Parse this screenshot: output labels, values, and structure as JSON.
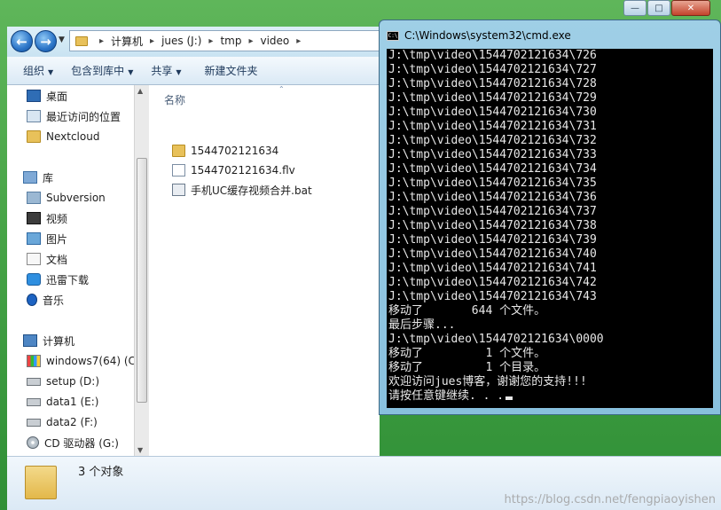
{
  "explorer": {
    "breadcrumb": [
      "计算机",
      "jues (J:)",
      "tmp",
      "video"
    ],
    "toolbar": {
      "organize": "组织",
      "include_in_library": "包含到库中",
      "share": "共享",
      "new_folder": "新建文件夹"
    },
    "nav": {
      "favorites": [
        "桌面",
        "最近访问的位置",
        "Nextcloud"
      ],
      "libraries_label": "库",
      "libraries": [
        "Subversion",
        "视频",
        "图片",
        "文档",
        "迅雷下载",
        "音乐"
      ],
      "computer_label": "计算机",
      "drives": [
        "windows7(64) (C",
        "setup (D:)",
        "data1 (E:)",
        "data2 (F:)",
        "CD 驱动器 (G:)"
      ]
    },
    "column_header": "名称",
    "files": [
      "1544702121634",
      "1544702121634.flv",
      "手机UC缓存视频合并.bat"
    ],
    "status": "3 个对象"
  },
  "cmd": {
    "title": "C:\\Windows\\system32\\cmd.exe",
    "lines": [
      "J:\\tmp\\video\\1544702121634\\726",
      "J:\\tmp\\video\\1544702121634\\727",
      "J:\\tmp\\video\\1544702121634\\728",
      "J:\\tmp\\video\\1544702121634\\729",
      "J:\\tmp\\video\\1544702121634\\730",
      "J:\\tmp\\video\\1544702121634\\731",
      "J:\\tmp\\video\\1544702121634\\732",
      "J:\\tmp\\video\\1544702121634\\733",
      "J:\\tmp\\video\\1544702121634\\734",
      "J:\\tmp\\video\\1544702121634\\735",
      "J:\\tmp\\video\\1544702121634\\736",
      "J:\\tmp\\video\\1544702121634\\737",
      "J:\\tmp\\video\\1544702121634\\738",
      "J:\\tmp\\video\\1544702121634\\739",
      "J:\\tmp\\video\\1544702121634\\740",
      "J:\\tmp\\video\\1544702121634\\741",
      "J:\\tmp\\video\\1544702121634\\742",
      "J:\\tmp\\video\\1544702121634\\743",
      "移动了       644 个文件。",
      "最后步骤...",
      "J:\\tmp\\video\\1544702121634\\0000",
      "移动了         1 个文件。",
      "移动了         1 个目录。",
      "欢迎访问jues博客，谢谢您的支持!!!",
      "请按任意键继续. . ."
    ]
  },
  "watermark": "https://blog.csdn.net/fengpiaoyishen"
}
